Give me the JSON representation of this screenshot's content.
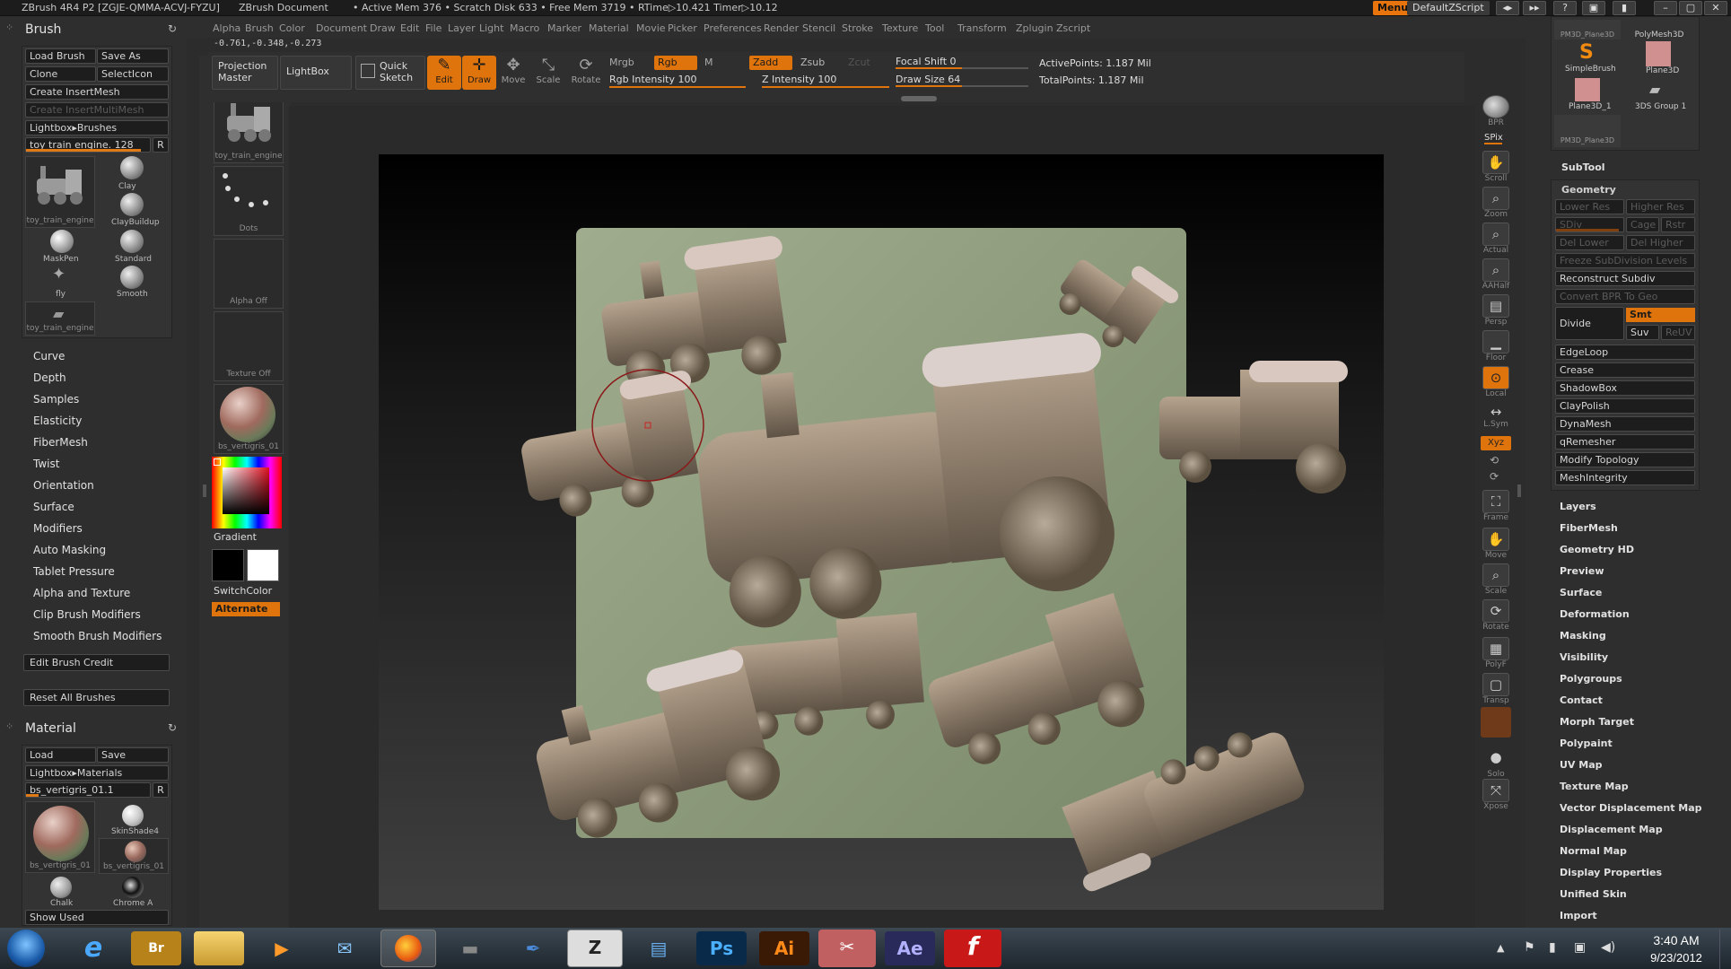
{
  "titlebar": {
    "app": "ZBrush 4R4 P2 [ZGJE-QMMA-ACVJ-FYZU]",
    "document": "ZBrush Document",
    "stats": "• Active Mem 376 • Scratch Disk 633 • Free Mem 3719 • RTime▷10.421 Timer▷10.12",
    "menus": "Menus",
    "zscript": "DefaultZScript"
  },
  "menubar": [
    "Alpha",
    "Brush",
    "Color",
    "Document",
    "Draw",
    "Edit",
    "File",
    "Layer",
    "Light",
    "Macro",
    "Marker",
    "Material",
    "Movie",
    "Picker",
    "Preferences",
    "Render",
    "Stencil",
    "Stroke",
    "Texture",
    "Tool",
    "Transform",
    "Zplugin",
    "Zscript"
  ],
  "coords": "-0.761,-0.348,-0.273",
  "brush_panel": {
    "title": "Brush",
    "load": "Load Brush",
    "save_as": "Save As",
    "clone": "Clone",
    "select_icon": "SelectIcon",
    "create_insert": "Create InsertMesh",
    "create_multi": "Create InsertMultiMesh",
    "lightbox": "Lightbox▸Brushes",
    "current": "toy train engine. 128",
    "r": "R",
    "thumbs": [
      {
        "name": "toy_train_engine"
      },
      {
        "name": "Clay"
      },
      {
        "name": "ClayBuildup"
      },
      {
        "name": "MaskPen"
      },
      {
        "name": "Standard"
      },
      {
        "name": "fly"
      },
      {
        "name": "Smooth"
      },
      {
        "name": "toy_train_engine"
      }
    ],
    "menu": [
      "Curve",
      "Depth",
      "Samples",
      "Elasticity",
      "FiberMesh",
      "Twist",
      "Orientation",
      "Surface",
      "Modifiers",
      "Auto Masking",
      "Tablet Pressure",
      "Alpha and Texture",
      "Clip Brush Modifiers",
      "Smooth Brush Modifiers"
    ],
    "edit_credit": "Edit Brush Credit",
    "reset": "Reset All Brushes"
  },
  "material_panel": {
    "title": "Material",
    "load": "Load",
    "save": "Save",
    "lightbox": "Lightbox▸Materials",
    "current": "bs_vertigris_01.1",
    "r": "R",
    "thumbs": [
      {
        "name": "bs_vertigris_01"
      },
      {
        "name": "SkinShade4"
      },
      {
        "name": "bs_vertigris_01"
      },
      {
        "name": "Chalk"
      },
      {
        "name": "Chrome A"
      }
    ],
    "show_used": "Show Used"
  },
  "left_tray": {
    "tool_cap": "toy_train_engine",
    "dots_cap": "Dots",
    "alpha_cap": "Alpha Off",
    "texture_cap": "Texture Off",
    "material_cap": "bs_vertigris_01",
    "gradient": "Gradient",
    "switch_color": "SwitchColor",
    "alternate": "Alternate"
  },
  "toolbar": {
    "projection_master": "Projection Master",
    "lightbox": "LightBox",
    "quick_sketch": "Quick Sketch",
    "tools": [
      {
        "label": "Edit",
        "icon": "edit-icon",
        "on": true
      },
      {
        "label": "Draw",
        "icon": "draw-icon",
        "on": true
      },
      {
        "label": "Move",
        "icon": "move-icon",
        "on": false
      },
      {
        "label": "Scale",
        "icon": "scale-icon",
        "on": false
      },
      {
        "label": "Rotate",
        "icon": "rotate-icon",
        "on": false
      }
    ],
    "mrgb": "Mrgb",
    "rgb": "Rgb",
    "m": "M",
    "zadd": "Zadd",
    "zsub": "Zsub",
    "zcut": "Zcut",
    "rgb_intensity": "Rgb Intensity 100",
    "z_intensity": "Z Intensity 100",
    "focal_shift": "Focal Shift 0",
    "draw_size": "Draw Size 64",
    "active_points": "ActivePoints: 1.187 Mil",
    "total_points": "TotalPoints: 1.187 Mil"
  },
  "shelf": [
    {
      "label": "BPR",
      "icon": "bpr-icon"
    },
    {
      "label": "SPix",
      "icon": "spix-icon"
    },
    {
      "label": "Scroll",
      "icon": "scroll-icon"
    },
    {
      "label": "Zoom",
      "icon": "zoom-icon"
    },
    {
      "label": "Actual",
      "icon": "actual-icon"
    },
    {
      "label": "AAHalf",
      "icon": "aahalf-icon"
    },
    {
      "label": "Persp",
      "icon": "persp-icon"
    },
    {
      "label": "Floor",
      "icon": "floor-icon"
    },
    {
      "label": "Local",
      "icon": "local-icon"
    },
    {
      "label": "L.Sym",
      "icon": "lsym-icon"
    },
    {
      "label": "Xyz",
      "icon": "xyz-icon"
    },
    {
      "label": "Frame",
      "icon": "frame-icon"
    },
    {
      "label": "Move",
      "icon": "move-icon"
    },
    {
      "label": "Scale",
      "icon": "scale-icon"
    },
    {
      "label": "Rotate",
      "icon": "rotate-icon"
    },
    {
      "label": "PolyF",
      "icon": "polyf-icon"
    },
    {
      "label": "Transp",
      "icon": "transp-icon"
    },
    {
      "label": "Solo",
      "icon": "solo-icon"
    },
    {
      "label": "Xpose",
      "icon": "xpose-icon"
    }
  ],
  "tool_palette": {
    "thumbs": [
      {
        "name": "PM3D_Plane3D"
      },
      {
        "name": "PolyMesh3D"
      },
      {
        "name": "SimpleBrush"
      },
      {
        "name": "Plane3D"
      },
      {
        "name": "Plane3D_1"
      },
      {
        "name": "3DS Group 1"
      },
      {
        "name": "PM3D_Plane3D"
      }
    ],
    "subtool": "SubTool",
    "geometry": "Geometry",
    "lower_res": "Lower Res",
    "higher_res": "Higher Res",
    "sdiv": "SDiv",
    "cage": "Cage",
    "rstr": "Rstr",
    "del_lower": "Del Lower",
    "del_higher": "Del Higher",
    "freeze": "Freeze SubDivision Levels",
    "reconstruct": "Reconstruct Subdiv",
    "convert_bpr": "Convert BPR To Geo",
    "divide": "Divide",
    "smt": "Smt",
    "suv": "Suv",
    "reuv": "ReUV",
    "geo_items": [
      "EdgeLoop",
      "Crease",
      "ShadowBox",
      "ClayPolish",
      "DynaMesh",
      "qRemesher",
      "Modify Topology",
      "MeshIntegrity"
    ],
    "sections": [
      "Layers",
      "FiberMesh",
      "Geometry HD",
      "Preview",
      "Surface",
      "Deformation",
      "Masking",
      "Visibility",
      "Polygroups",
      "Contact",
      "Morph Target",
      "Polypaint",
      "UV Map",
      "Texture Map",
      "Vector Displacement Map",
      "Displacement Map",
      "Normal Map",
      "Display Properties",
      "Unified Skin",
      "Import"
    ]
  },
  "taskbar": {
    "time": "3:40 AM",
    "date": "9/23/2012",
    "apps": [
      {
        "icon": "start-orb-icon",
        "glyph": ""
      },
      {
        "icon": "internet-explorer-icon",
        "glyph": "e"
      },
      {
        "icon": "bridge-icon",
        "glyph": "Br"
      },
      {
        "icon": "folder-icon",
        "glyph": ""
      },
      {
        "icon": "media-player-icon",
        "glyph": "▶"
      },
      {
        "icon": "thunderbird-icon",
        "glyph": "✉"
      },
      {
        "icon": "firefox-icon",
        "glyph": ""
      },
      {
        "icon": "eraser-icon",
        "glyph": ""
      },
      {
        "icon": "pen-icon",
        "glyph": ""
      },
      {
        "icon": "zbrush-icon",
        "glyph": "Z"
      },
      {
        "icon": "notepad-icon",
        "glyph": ""
      },
      {
        "icon": "photoshop-icon",
        "glyph": "Ps"
      },
      {
        "icon": "illustrator-icon",
        "glyph": "Ai"
      },
      {
        "icon": "snipping-icon",
        "glyph": "✂"
      },
      {
        "icon": "after-effects-icon",
        "glyph": "Ae"
      },
      {
        "icon": "flash-icon",
        "glyph": "f"
      }
    ]
  },
  "colors": {
    "accent": "#e0740c",
    "panel": "#333333",
    "canvas_bg": "#3a3a3a",
    "plane": "#8a9a7a"
  }
}
